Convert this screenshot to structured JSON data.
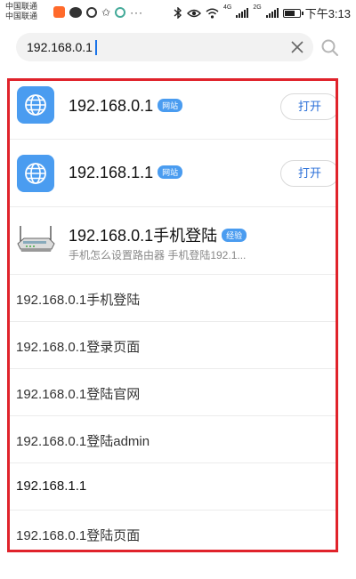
{
  "status_bar": {
    "carrier1": "中国联通",
    "carrier2": "中国联通",
    "signal1": "4G",
    "signal2": "2G",
    "time": "下午3:13",
    "left_icons": [
      "taobao-icon",
      "wechat-icon",
      "settings-icon",
      "star-icon",
      "o-app-icon",
      "more-dots-icon"
    ],
    "right_icons": [
      "bluetooth-icon",
      "eye-icon",
      "wifi-icon",
      "signal-icon",
      "battery-icon"
    ]
  },
  "search": {
    "value": "192.168.0.1"
  },
  "suggestions": {
    "sites": [
      {
        "title": "192.168.0.1",
        "tag": "网站",
        "button": "打开"
      },
      {
        "title": "192.168.1.1",
        "tag": "网站",
        "button": "打开"
      }
    ],
    "experience": {
      "title": "192.168.0.1手机登陆",
      "tag": "经验",
      "subtitle": "手机怎么设置路由器 手机登陆192.1..."
    },
    "queries": [
      "192.168.0.1手机登陆",
      "192.168.0.1登录页面",
      "192.168.0.1登陆官网",
      "192.168.0.1登陆admin",
      "192.168.1.1",
      "192.168.0.1登陆页面"
    ]
  },
  "colors": {
    "accent": "#e0232b",
    "site_icon": "#4a9cf0",
    "button_text": "#2a6fd8"
  }
}
